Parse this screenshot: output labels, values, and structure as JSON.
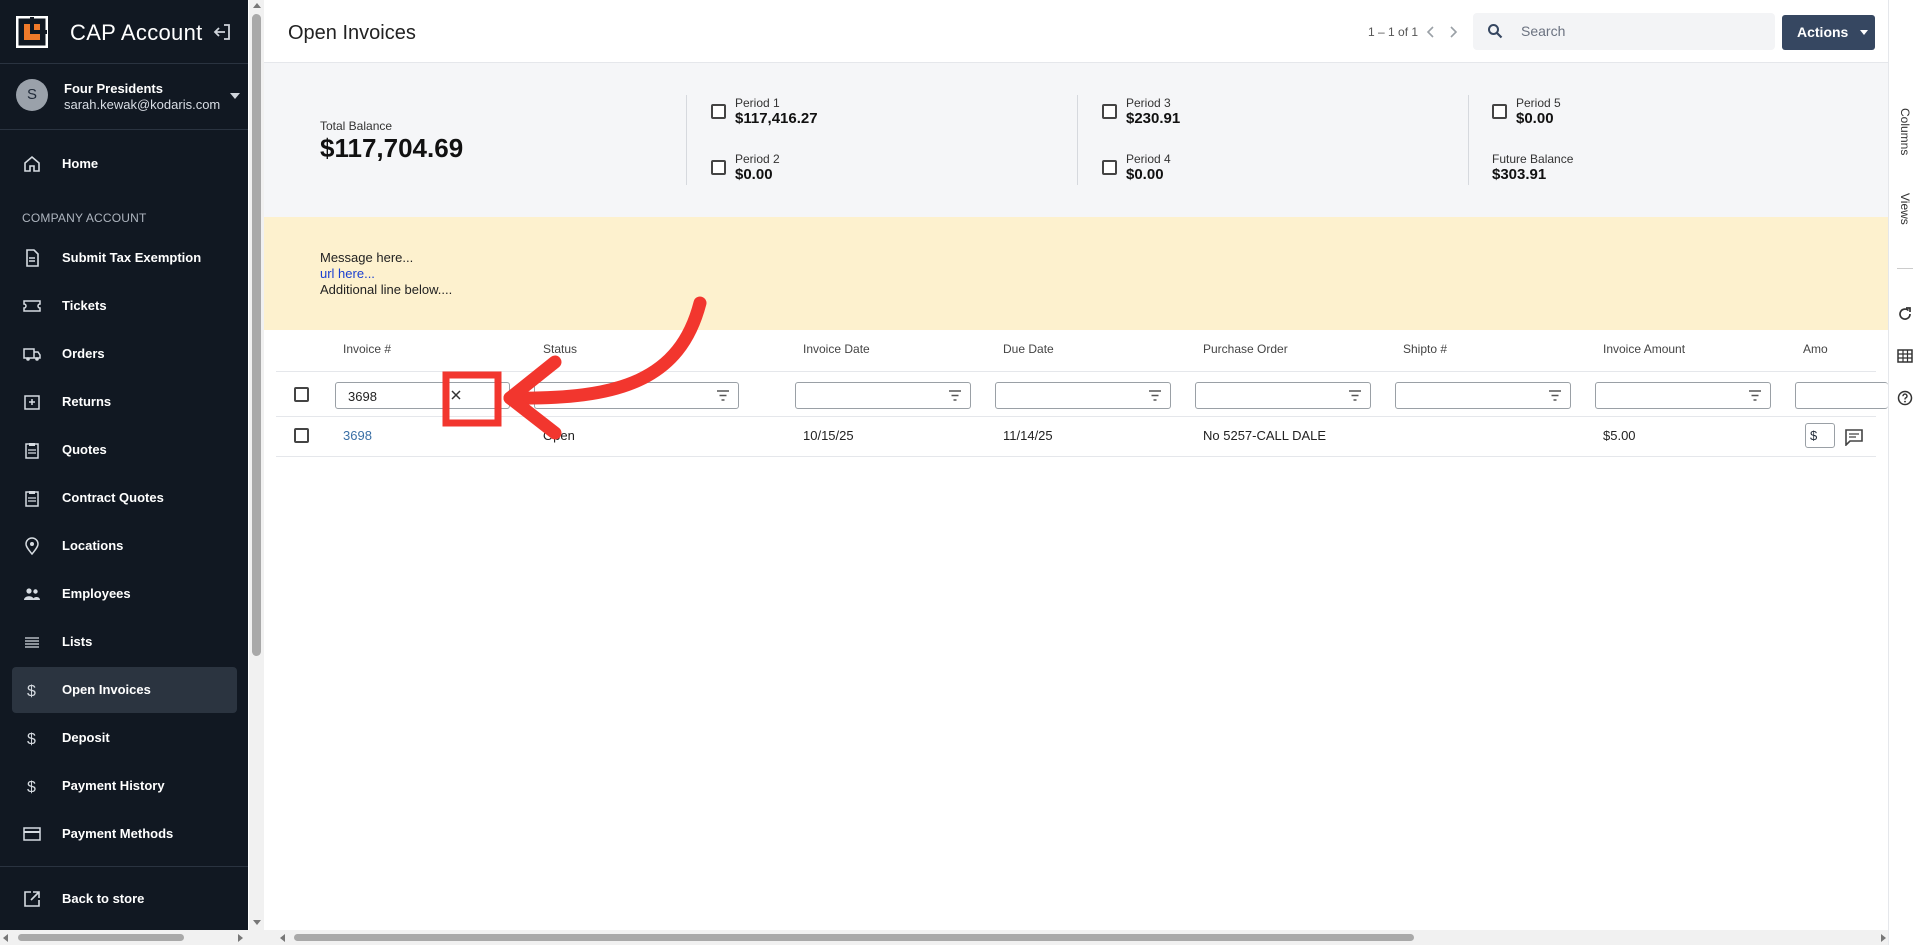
{
  "sidebar": {
    "app_title": "CAP Account",
    "user": {
      "avatar_initial": "S",
      "name": "Four Presidents",
      "email": "sarah.kewak@kodaris.com"
    },
    "section_label": "COMPANY ACCOUNT",
    "items": [
      {
        "label": "Home",
        "icon": "home-icon"
      },
      {
        "label": "Submit Tax Exemption",
        "icon": "document-icon"
      },
      {
        "label": "Tickets",
        "icon": "ticket-icon"
      },
      {
        "label": "Orders",
        "icon": "truck-icon"
      },
      {
        "label": "Returns",
        "icon": "return-icon"
      },
      {
        "label": "Quotes",
        "icon": "clipboard-icon"
      },
      {
        "label": "Contract Quotes",
        "icon": "clipboard-icon"
      },
      {
        "label": "Locations",
        "icon": "location-pin-icon"
      },
      {
        "label": "Employees",
        "icon": "people-icon"
      },
      {
        "label": "Lists",
        "icon": "list-icon"
      },
      {
        "label": "Open Invoices",
        "icon": "dollar-icon",
        "active": true
      },
      {
        "label": "Deposit",
        "icon": "dollar-icon"
      },
      {
        "label": "Payment History",
        "icon": "dollar-icon"
      },
      {
        "label": "Payment Methods",
        "icon": "credit-card-icon"
      }
    ],
    "back_label": "Back to store"
  },
  "header": {
    "title": "Open Invoices",
    "pager_text": "1 – 1 of 1",
    "search_placeholder": "Search",
    "actions_label": "Actions"
  },
  "balances": {
    "total_label": "Total Balance",
    "total_value": "$117,704.69",
    "period1_label": "Period 1",
    "period1_value": "$117,416.27",
    "period2_label": "Period 2",
    "period2_value": "$0.00",
    "period3_label": "Period 3",
    "period3_value": "$230.91",
    "period4_label": "Period 4",
    "period4_value": "$0.00",
    "period5_label": "Period 5",
    "period5_value": "$0.00",
    "future_label": "Future Balance",
    "future_value": "$303.91"
  },
  "banner": {
    "line1": "Message here...",
    "link": "url here...",
    "line3": "Additional line below...."
  },
  "table": {
    "columns": [
      "Invoice #",
      "Status",
      "Invoice Date",
      "Due Date",
      "Purchase Order",
      "Shipto #",
      "Invoice Amount",
      "Amo"
    ],
    "filter_invoice_value": "3698",
    "rows": [
      {
        "invoice": "3698",
        "status": "Open",
        "invoice_date": "10/15/25",
        "due_date": "11/14/25",
        "purchase_order": "No 5257-CALL DALE",
        "shipto": "",
        "invoice_amount": "$5.00",
        "amount_prefix": "$"
      }
    ]
  },
  "right_rail": {
    "columns_label": "Columns",
    "views_label": "Views"
  },
  "colors": {
    "sidebar_bg": "#111822",
    "accent": "#364761",
    "banner_bg": "#fdf1ce",
    "annotation": "#f2362e",
    "link": "#3a6fa5"
  }
}
